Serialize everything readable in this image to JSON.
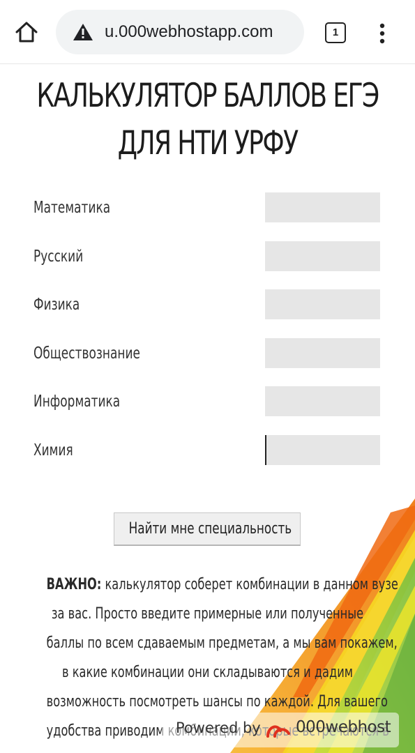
{
  "browser": {
    "url": "u.000webhostapp.com",
    "tab_count": "1",
    "home_icon": "home-icon",
    "security_icon": "warning-icon",
    "menu_icon": "more-vert-icon"
  },
  "page": {
    "title_line1": "КАЛЬКУЛЯТОР БАЛЛОВ ЕГЭ",
    "title_line2": "ДЛЯ НТИ УРФУ"
  },
  "form": {
    "fields": [
      {
        "label": "Математика",
        "value": ""
      },
      {
        "label": "Русский",
        "value": ""
      },
      {
        "label": "Физика",
        "value": ""
      },
      {
        "label": "Обществознание",
        "value": ""
      },
      {
        "label": "Информатика",
        "value": ""
      },
      {
        "label": "Химия",
        "value": ""
      }
    ],
    "submit_label": "Найти мне специальность"
  },
  "info": {
    "important_label": "ВАЖНО:",
    "lines": [
      " калькулятор соберет комбинации в данном вузе",
      "за вас. Просто введите примерные или полученные",
      "баллы по всем сдаваемым предметам, а мы вам покажем,",
      "в какие комбинации они складываются и дадим",
      "возможность посмотреть шансы по каждой. Для вашего",
      "удобства приводим комбинации, которые встречаются в"
    ]
  },
  "badge": {
    "powered_label": "Powered by",
    "brand": "000webhost"
  },
  "colors": {
    "stripe_orange": "#f39a1a",
    "stripe_yellow": "#f7d21e",
    "stripe_green": "#8fc43c",
    "input_bg": "#e6e6e6",
    "urlbar_bg": "#f1f3f4"
  }
}
